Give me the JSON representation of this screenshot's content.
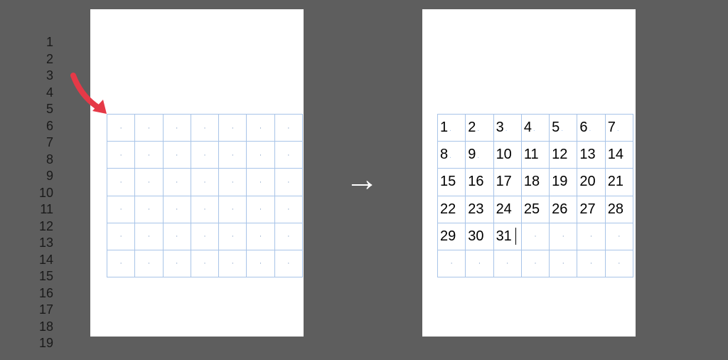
{
  "line_numbers": [
    1,
    2,
    3,
    4,
    5,
    6,
    7,
    8,
    9,
    10,
    11,
    12,
    13,
    14,
    15,
    16,
    17,
    18,
    19
  ],
  "grid_left": {
    "rows": 6,
    "cols": 7,
    "cells": [
      [
        null,
        null,
        null,
        null,
        null,
        null,
        null
      ],
      [
        null,
        null,
        null,
        null,
        null,
        null,
        null
      ],
      [
        null,
        null,
        null,
        null,
        null,
        null,
        null
      ],
      [
        null,
        null,
        null,
        null,
        null,
        null,
        null
      ],
      [
        null,
        null,
        null,
        null,
        null,
        null,
        null
      ],
      [
        null,
        null,
        null,
        null,
        null,
        null,
        null
      ]
    ]
  },
  "grid_right": {
    "rows": 6,
    "cols": 7,
    "cells": [
      [
        1,
        2,
        3,
        4,
        5,
        6,
        7
      ],
      [
        8,
        9,
        10,
        11,
        12,
        13,
        14
      ],
      [
        15,
        16,
        17,
        18,
        19,
        20,
        21
      ],
      [
        22,
        23,
        24,
        25,
        26,
        27,
        28
      ],
      [
        29,
        30,
        31,
        null,
        null,
        null,
        null
      ],
      [
        null,
        null,
        null,
        null,
        null,
        null,
        null
      ]
    ],
    "cursor_after": 31
  },
  "arrow_glyph": "→",
  "colors": {
    "background": "#5e5e5e",
    "page": "#ffffff",
    "grid_line": "#a8c4e8",
    "arrow_red": "#e53947",
    "arrow_white": "#ffffff"
  }
}
